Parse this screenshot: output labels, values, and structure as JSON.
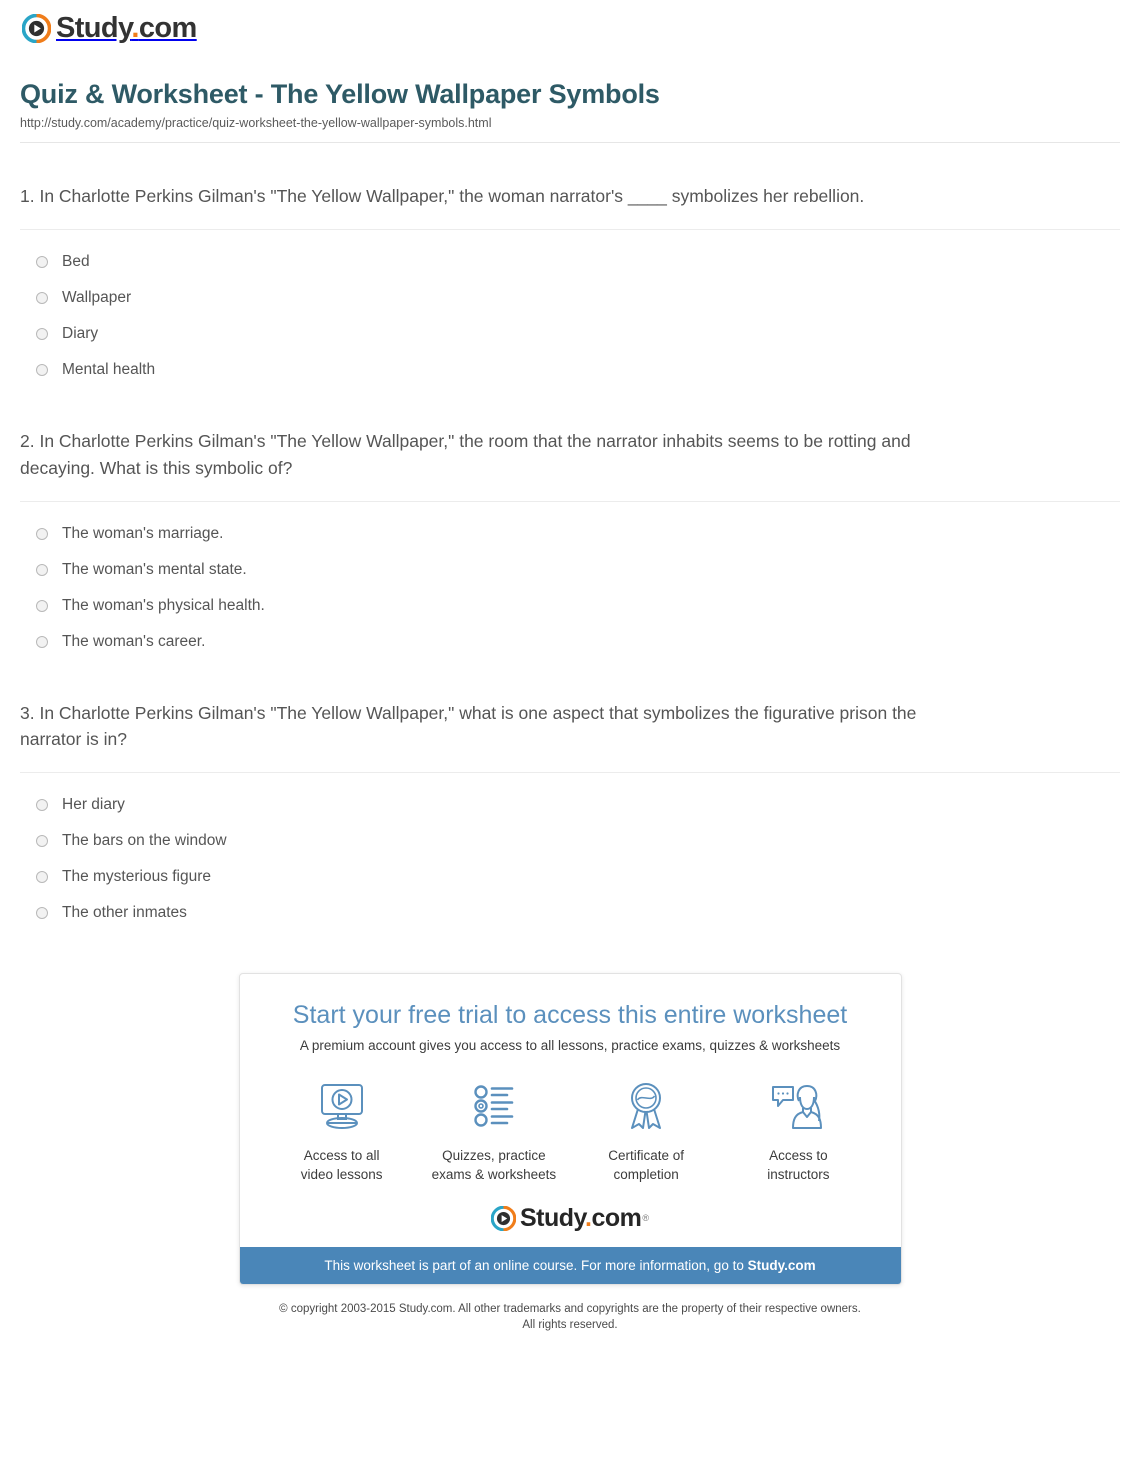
{
  "brand": {
    "name_main": "Study",
    "name_dot": ".",
    "name_tld": "com",
    "logo_icon": "play-circle-icon"
  },
  "header": {
    "title": "Quiz & Worksheet - The Yellow Wallpaper Symbols",
    "url": "http://study.com/academy/practice/quiz-worksheet-the-yellow-wallpaper-symbols.html"
  },
  "questions": [
    {
      "text": "1. In Charlotte Perkins Gilman's \"The Yellow Wallpaper,\" the woman narrator's ____ symbolizes her rebellion.",
      "options": [
        "Bed",
        "Wallpaper",
        "Diary",
        "Mental health"
      ]
    },
    {
      "text": "2. In Charlotte Perkins Gilman's \"The Yellow Wallpaper,\" the room that the narrator inhabits seems to be rotting and decaying. What is this symbolic of?",
      "options": [
        "The woman's marriage.",
        "The woman's mental state.",
        "The woman's physical health.",
        "The woman's career."
      ]
    },
    {
      "text": "3. In Charlotte Perkins Gilman's \"The Yellow Wallpaper,\" what is one aspect that symbolizes the figurative prison the narrator is in?",
      "options": [
        "Her diary",
        "The bars on the window",
        "The mysterious figure",
        "The other inmates"
      ]
    }
  ],
  "promo": {
    "title": "Start your free trial to access this entire worksheet",
    "subtitle": "A premium account gives you access to all lessons, practice exams, quizzes & worksheets",
    "features": [
      {
        "icon": "monitor-play-icon",
        "line1": "Access to all",
        "line2": "video lessons"
      },
      {
        "icon": "checklist-icon",
        "line1": "Quizzes, practice",
        "line2": "exams & worksheets"
      },
      {
        "icon": "award-ribbon-icon",
        "line1": "Certificate of",
        "line2": "completion"
      },
      {
        "icon": "instructor-chat-icon",
        "line1": "Access to",
        "line2": "instructors"
      }
    ],
    "logo_main": "Study",
    "logo_dot": ".",
    "logo_tld": "com",
    "logo_tm": "®",
    "footer_text": "This worksheet is part of an online course. For more information, go to ",
    "footer_link": "Study.com"
  },
  "copyright": {
    "line1": "© copyright 2003-2015 Study.com. All other trademarks and copyrights are the property of their respective owners.",
    "line2": "All rights reserved."
  },
  "colors": {
    "title": "#2e5a66",
    "promo_title": "#5b90bd",
    "footer_bar": "#4a86b8",
    "logo_orange": "#f07d1a",
    "logo_blue": "#2aa5c7",
    "icon_blue": "#5b90bd"
  }
}
